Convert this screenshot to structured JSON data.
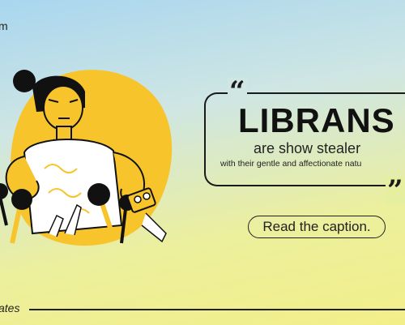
{
  "header": {
    "partial_text": "m"
  },
  "hero": {
    "headline": "LIBRANS",
    "subheadline": "are show stealer",
    "tagline": "with their gentle and  affectionate natu",
    "quote_open_icon": "open-quote-icon",
    "quote_close_icon": "close-quote-icon"
  },
  "cta": {
    "label": "Read the caption."
  },
  "footer": {
    "partial_text": "ates"
  },
  "colors": {
    "accent_yellow": "#f7c52b",
    "ink": "#1a1a1a",
    "gradient_top": "#a9d6ef",
    "gradient_bottom": "#f2ef8a"
  }
}
